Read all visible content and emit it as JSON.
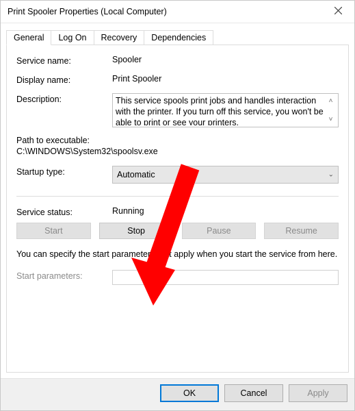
{
  "window": {
    "title": "Print Spooler Properties (Local Computer)"
  },
  "tabs": {
    "general": "General",
    "logon": "Log On",
    "recovery": "Recovery",
    "dependencies": "Dependencies"
  },
  "general": {
    "service_name_label": "Service name:",
    "service_name_value": "Spooler",
    "display_name_label": "Display name:",
    "display_name_value": "Print Spooler",
    "description_label": "Description:",
    "description_value": "This service spools print jobs and handles interaction with the printer.  If you turn off this service, you won't be able to print or see your printers.",
    "path_label": "Path to executable:",
    "path_value": "C:\\WINDOWS\\System32\\spoolsv.exe",
    "startup_label": "Startup type:",
    "startup_value": "Automatic",
    "status_label": "Service status:",
    "status_value": "Running",
    "buttons": {
      "start": "Start",
      "stop": "Stop",
      "pause": "Pause",
      "resume": "Resume"
    },
    "help_text": "You can specify the start parameters that apply when you start the service from here.",
    "start_params_label": "Start parameters:",
    "start_params_value": ""
  },
  "dialog_buttons": {
    "ok": "OK",
    "cancel": "Cancel",
    "apply": "Apply"
  },
  "annotation": {
    "color": "#ff0000"
  }
}
